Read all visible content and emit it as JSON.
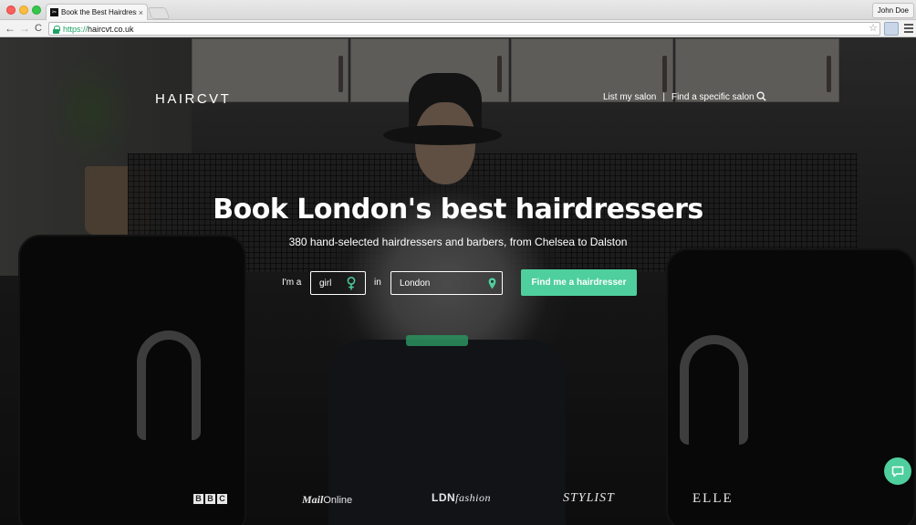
{
  "browser": {
    "tab_title": "Book the Best Hairdressers",
    "tab_close": "×",
    "profile_name": "John Doe",
    "url_scheme": "https://",
    "url_host": "haircvt.co.uk",
    "nav_back": "←",
    "nav_forward": "→",
    "nav_reload": "C",
    "star": "☆"
  },
  "header": {
    "logo": "HAIRCVT",
    "nav": [
      {
        "label": "List my salon"
      },
      {
        "label": "Find a specific salon"
      }
    ],
    "separator": "|"
  },
  "hero": {
    "headline": "Book London's best hairdressers",
    "subline": "380 hand-selected hairdressers and barbers, from Chelsea to Dalston"
  },
  "search_form": {
    "prefix_label": "I'm a",
    "gender_value": "girl",
    "in_label": "in",
    "location_value": "London",
    "button_label": "Find me a hairdresser"
  },
  "press": {
    "bbc": [
      "B",
      "B",
      "C"
    ],
    "mail_bold": "Mail",
    "mail_rest": "Online",
    "ldn_bold": "LDN",
    "ldn_italic": "fashion",
    "stylist": "STYLIST",
    "elle": "ELLE"
  },
  "colors": {
    "accent": "#4ecf9d",
    "secure_green": "#1da462"
  },
  "icons": {
    "search": "search-icon",
    "gender": "female-icon",
    "location": "map-pin-icon",
    "chat": "chat-bubble-icon"
  }
}
